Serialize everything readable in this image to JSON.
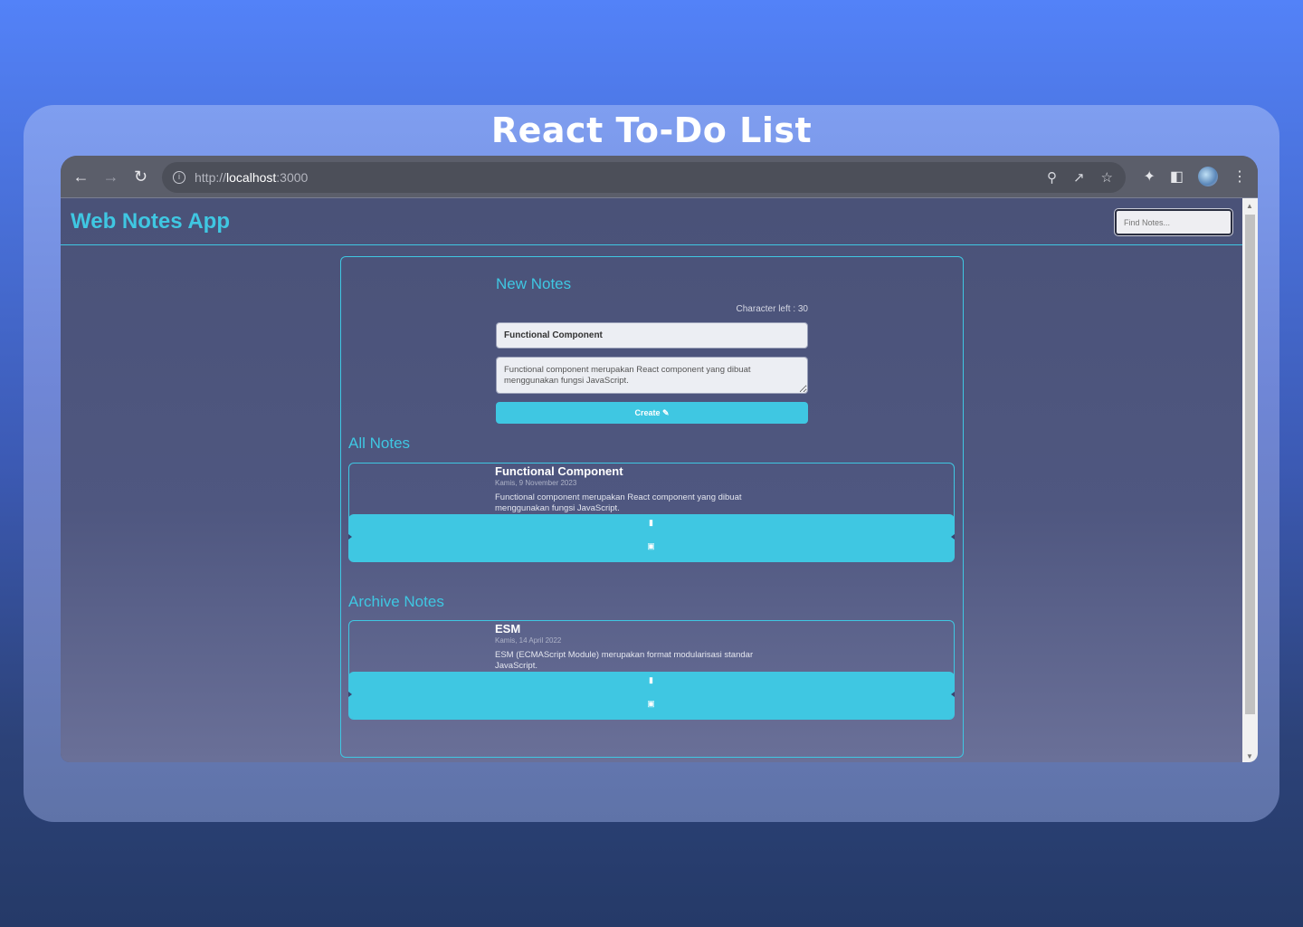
{
  "showcase": {
    "title": "React To-Do List"
  },
  "browser": {
    "url_prefix": "http://",
    "url_host": "localhost",
    "url_port": ":3000",
    "icons": {
      "back": "back-arrow-icon",
      "forward": "forward-arrow-icon",
      "reload": "reload-icon"
    }
  },
  "app": {
    "brand": "Web Notes App",
    "search_placeholder": "Find Notes..."
  },
  "new_notes": {
    "heading": "New Notes",
    "char_left": "Character left : 30",
    "title_value": "Functional Component",
    "body_value": "Functional component merupakan React component yang dibuat menggunakan fungsi JavaScript.",
    "create_label": "Create"
  },
  "all_notes": {
    "heading": "All Notes",
    "notes": [
      {
        "title": "Functional Component",
        "date": "Kamis, 9 November 2023",
        "body": "Functional component merupakan React component yang dibuat menggunakan fungsi JavaScript."
      }
    ]
  },
  "archive_notes": {
    "heading": "Archive Notes",
    "notes": [
      {
        "title": "ESM",
        "date": "Kamis, 14 April 2022",
        "body": "ESM (ECMAScript Module) merupakan format modularisasi standar JavaScript."
      }
    ]
  },
  "colors": {
    "accent": "#3fc7e2",
    "page_bg": "#4a5278"
  }
}
